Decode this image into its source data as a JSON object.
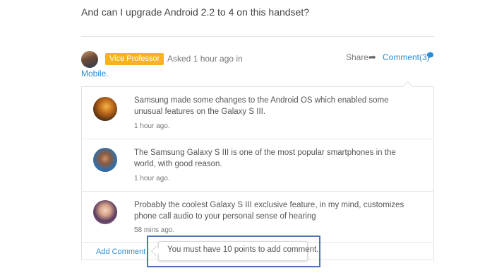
{
  "question": {
    "text": "And can I upgrade Android 2.2 to 4 on this handset?"
  },
  "meta": {
    "badge": "Vice Professor",
    "asked": "Asked 1 hour ago in",
    "category": "Mobile.",
    "share_label": "Share",
    "share_icon": "share-arrow-icon",
    "comments_label": "Comment(3)",
    "comments_icon": "speech-bubble-icon",
    "badge_color": "#f5b41e",
    "link_color": "#2e8bd0"
  },
  "comments": [
    {
      "text": "Samsung made some changes to the Android OS which enabled some unusual features on the Galaxy S III.",
      "time": "1 hour ago."
    },
    {
      "text": "The Samsung Galaxy S III is one of the most popular smartphones in the world, with good reason.",
      "time": "1 hour ago."
    },
    {
      "text": "Probably the coolest Galaxy S III exclusive feature, in my mind, customizes phone call audio to your personal sense of hearing",
      "time": "58 mins ago."
    }
  ],
  "add_comment": {
    "label": "Add Comment"
  },
  "tooltip": {
    "text": "You must have 10 points to add comment."
  }
}
